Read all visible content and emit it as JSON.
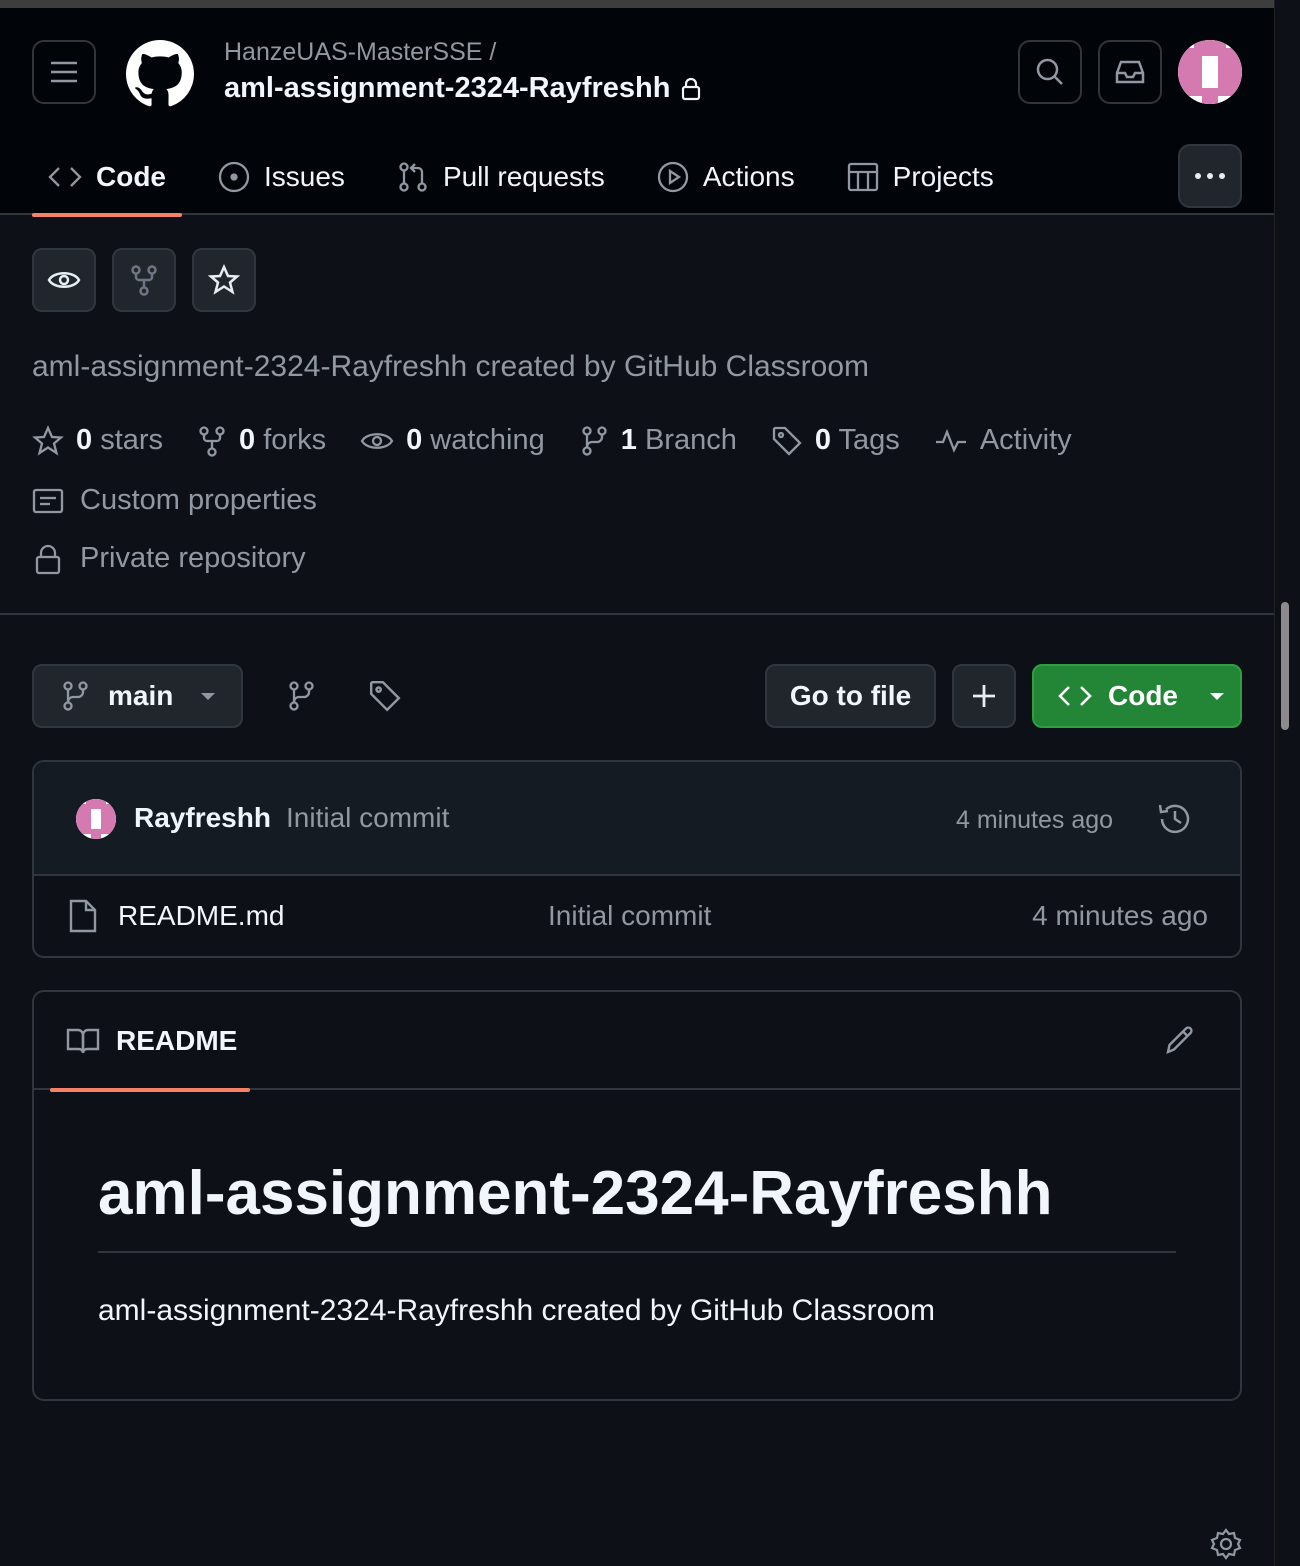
{
  "header": {
    "owner": "HanzeUAS-MasterSSE /",
    "repo": "aml-assignment-2324-Rayfreshh"
  },
  "tabs": [
    {
      "label": "Code",
      "icon": "code-icon",
      "active": true
    },
    {
      "label": "Issues",
      "icon": "issue-icon"
    },
    {
      "label": "Pull requests",
      "icon": "pull-request-icon"
    },
    {
      "label": "Actions",
      "icon": "play-icon"
    },
    {
      "label": "Projects",
      "icon": "table-icon"
    }
  ],
  "description": "aml-assignment-2324-Rayfreshh created by GitHub Classroom",
  "stats": {
    "stars_count": "0",
    "stars_label": "stars",
    "forks_count": "0",
    "forks_label": "forks",
    "watching_count": "0",
    "watching_label": "watching",
    "branch_count": "1",
    "branch_label": "Branch",
    "tags_count": "0",
    "tags_label": "Tags",
    "activity_label": "Activity"
  },
  "custom_properties": "Custom properties",
  "private_repository": "Private repository",
  "toolbar": {
    "branch": "main",
    "go_to_file": "Go to file",
    "code": "Code"
  },
  "commit": {
    "author": "Rayfreshh",
    "message": "Initial commit",
    "time": "4 minutes ago"
  },
  "files": [
    {
      "name": "README.md",
      "message": "Initial commit",
      "time": "4 minutes ago"
    }
  ],
  "readme": {
    "tab_label": "README",
    "title": "aml-assignment-2324-Rayfreshh",
    "body": "aml-assignment-2324-Rayfreshh created by GitHub Classroom"
  },
  "colors": {
    "background": "#0d1117",
    "header_bg": "#010409",
    "accent_underline": "#f78166",
    "code_button": "#238636",
    "avatar_pink": "#d47ab0"
  }
}
